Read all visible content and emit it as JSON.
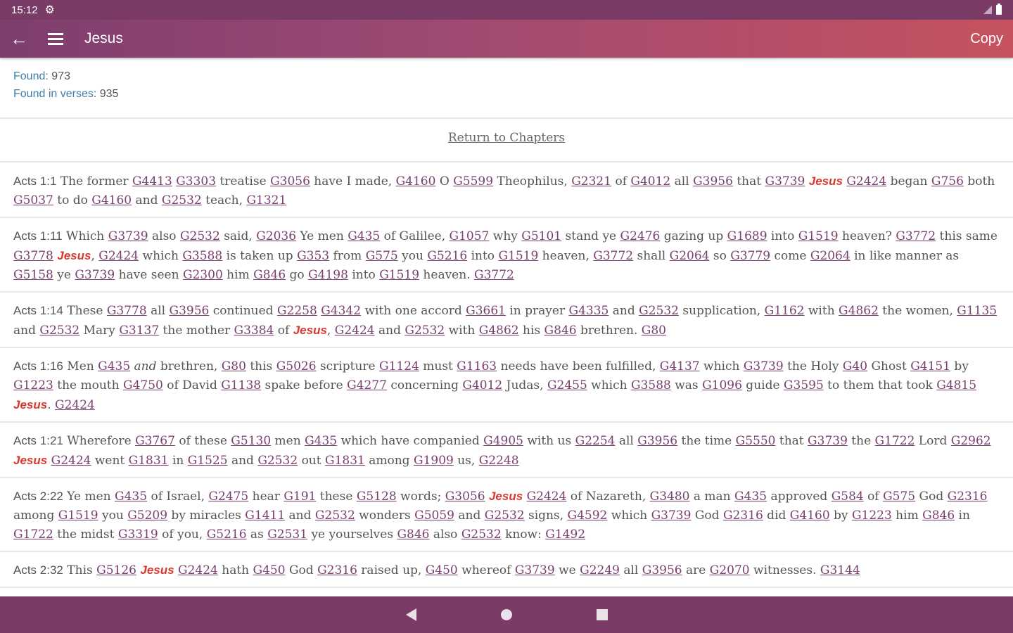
{
  "status_bar": {
    "time": "15:12",
    "gear_icon": "⚙"
  },
  "app_bar": {
    "title": "Jesus",
    "copy_label": "Copy",
    "back_icon": "←"
  },
  "summary": {
    "found_label": "Found:",
    "found_value": "973",
    "verses_label": "Found in verses:",
    "verses_value": "935"
  },
  "return_label": "Return to Chapters",
  "verses": [
    {
      "ref": "Acts 1:1",
      "tokens": [
        {
          "t": "The former "
        },
        {
          "s": "G4413"
        },
        {
          "t": " "
        },
        {
          "s": "G3303"
        },
        {
          "t": " treatise "
        },
        {
          "s": "G3056"
        },
        {
          "t": " have I made, "
        },
        {
          "s": "G4160"
        },
        {
          "t": " O "
        },
        {
          "s": "G5599"
        },
        {
          "t": " Theophilus, "
        },
        {
          "s": "G2321"
        },
        {
          "t": " of "
        },
        {
          "s": "G4012"
        },
        {
          "t": " all "
        },
        {
          "s": "G3956"
        },
        {
          "t": " that "
        },
        {
          "s": "G3739"
        },
        {
          "t": " "
        },
        {
          "j": "Jesus"
        },
        {
          "t": " "
        },
        {
          "s": "G2424"
        },
        {
          "t": " began "
        },
        {
          "s": "G756"
        },
        {
          "t": " both "
        },
        {
          "s": "G5037"
        },
        {
          "t": " to do "
        },
        {
          "s": "G4160"
        },
        {
          "t": " and "
        },
        {
          "s": "G2532"
        },
        {
          "t": " teach, "
        },
        {
          "s": "G1321"
        }
      ]
    },
    {
      "ref": "Acts 1:11",
      "tokens": [
        {
          "t": "Which "
        },
        {
          "s": "G3739"
        },
        {
          "t": " also "
        },
        {
          "s": "G2532"
        },
        {
          "t": " said, "
        },
        {
          "s": "G2036"
        },
        {
          "t": " Ye men "
        },
        {
          "s": "G435"
        },
        {
          "t": " of Galilee, "
        },
        {
          "s": "G1057"
        },
        {
          "t": " why "
        },
        {
          "s": "G5101"
        },
        {
          "t": " stand ye "
        },
        {
          "s": "G2476"
        },
        {
          "t": " gazing up "
        },
        {
          "s": "G1689"
        },
        {
          "t": " into "
        },
        {
          "s": "G1519"
        },
        {
          "t": " heaven? "
        },
        {
          "s": "G3772"
        },
        {
          "t": " this same "
        },
        {
          "s": "G3778"
        },
        {
          "t": " "
        },
        {
          "j": "Jesus"
        },
        {
          "t": ", "
        },
        {
          "s": "G2424"
        },
        {
          "t": " which "
        },
        {
          "s": "G3588"
        },
        {
          "t": " is taken up "
        },
        {
          "s": "G353"
        },
        {
          "t": " from "
        },
        {
          "s": "G575"
        },
        {
          "t": " you "
        },
        {
          "s": "G5216"
        },
        {
          "t": " into "
        },
        {
          "s": "G1519"
        },
        {
          "t": " heaven, "
        },
        {
          "s": "G3772"
        },
        {
          "t": " shall "
        },
        {
          "s": "G2064"
        },
        {
          "t": " so "
        },
        {
          "s": "G3779"
        },
        {
          "t": " come "
        },
        {
          "s": "G2064"
        },
        {
          "t": " in like manner as "
        },
        {
          "s": "G5158"
        },
        {
          "t": " ye "
        },
        {
          "s": "G3739"
        },
        {
          "t": " have seen "
        },
        {
          "s": "G2300"
        },
        {
          "t": " him "
        },
        {
          "s": "G846"
        },
        {
          "t": " go "
        },
        {
          "s": "G4198"
        },
        {
          "t": " into "
        },
        {
          "s": "G1519"
        },
        {
          "t": " heaven. "
        },
        {
          "s": "G3772"
        }
      ]
    },
    {
      "ref": "Acts 1:14",
      "tokens": [
        {
          "t": "These "
        },
        {
          "s": "G3778"
        },
        {
          "t": " all "
        },
        {
          "s": "G3956"
        },
        {
          "t": " continued "
        },
        {
          "s": "G2258"
        },
        {
          "t": " "
        },
        {
          "s": "G4342"
        },
        {
          "t": " with one accord "
        },
        {
          "s": "G3661"
        },
        {
          "t": " in prayer "
        },
        {
          "s": "G4335"
        },
        {
          "t": " and "
        },
        {
          "s": "G2532"
        },
        {
          "t": " supplication, "
        },
        {
          "s": "G1162"
        },
        {
          "t": " with "
        },
        {
          "s": "G4862"
        },
        {
          "t": " the women, "
        },
        {
          "s": "G1135"
        },
        {
          "t": " and "
        },
        {
          "s": "G2532"
        },
        {
          "t": " Mary "
        },
        {
          "s": "G3137"
        },
        {
          "t": " the mother "
        },
        {
          "s": "G3384"
        },
        {
          "t": " of "
        },
        {
          "j": "Jesus"
        },
        {
          "t": ", "
        },
        {
          "s": "G2424"
        },
        {
          "t": " and "
        },
        {
          "s": "G2532"
        },
        {
          "t": " with "
        },
        {
          "s": "G4862"
        },
        {
          "t": " his "
        },
        {
          "s": "G846"
        },
        {
          "t": " brethren. "
        },
        {
          "s": "G80"
        }
      ]
    },
    {
      "ref": "Acts 1:16",
      "tokens": [
        {
          "t": "Men "
        },
        {
          "s": "G435"
        },
        {
          "t": " "
        },
        {
          "i": "and"
        },
        {
          "t": " brethren, "
        },
        {
          "s": "G80"
        },
        {
          "t": " this "
        },
        {
          "s": "G5026"
        },
        {
          "t": " scripture "
        },
        {
          "s": "G1124"
        },
        {
          "t": " must "
        },
        {
          "s": "G1163"
        },
        {
          "t": " needs have been fulfilled, "
        },
        {
          "s": "G4137"
        },
        {
          "t": " which "
        },
        {
          "s": "G3739"
        },
        {
          "t": " the Holy "
        },
        {
          "s": "G40"
        },
        {
          "t": " Ghost "
        },
        {
          "s": "G4151"
        },
        {
          "t": " by "
        },
        {
          "s": "G1223"
        },
        {
          "t": " the mouth "
        },
        {
          "s": "G4750"
        },
        {
          "t": " of David "
        },
        {
          "s": "G1138"
        },
        {
          "t": " spake before "
        },
        {
          "s": "G4277"
        },
        {
          "t": " concerning "
        },
        {
          "s": "G4012"
        },
        {
          "t": " Judas, "
        },
        {
          "s": "G2455"
        },
        {
          "t": " which "
        },
        {
          "s": "G3588"
        },
        {
          "t": " was "
        },
        {
          "s": "G1096"
        },
        {
          "t": " guide "
        },
        {
          "s": "G3595"
        },
        {
          "t": " to them that took "
        },
        {
          "s": "G4815"
        },
        {
          "t": " "
        },
        {
          "j": "Jesus"
        },
        {
          "t": ". "
        },
        {
          "s": "G2424"
        }
      ]
    },
    {
      "ref": "Acts 1:21",
      "tokens": [
        {
          "t": "Wherefore "
        },
        {
          "s": "G3767"
        },
        {
          "t": " of these "
        },
        {
          "s": "G5130"
        },
        {
          "t": " men "
        },
        {
          "s": "G435"
        },
        {
          "t": " which have companied "
        },
        {
          "s": "G4905"
        },
        {
          "t": " with us "
        },
        {
          "s": "G2254"
        },
        {
          "t": " all "
        },
        {
          "s": "G3956"
        },
        {
          "t": " the time "
        },
        {
          "s": "G5550"
        },
        {
          "t": " that "
        },
        {
          "s": "G3739"
        },
        {
          "t": " the "
        },
        {
          "s": "G1722"
        },
        {
          "t": " Lord "
        },
        {
          "s": "G2962"
        },
        {
          "t": " "
        },
        {
          "j": "Jesus"
        },
        {
          "t": " "
        },
        {
          "s": "G2424"
        },
        {
          "t": " went "
        },
        {
          "s": "G1831"
        },
        {
          "t": " in "
        },
        {
          "s": "G1525"
        },
        {
          "t": " and "
        },
        {
          "s": "G2532"
        },
        {
          "t": " out "
        },
        {
          "s": "G1831"
        },
        {
          "t": " among "
        },
        {
          "s": "G1909"
        },
        {
          "t": " us, "
        },
        {
          "s": "G2248"
        }
      ]
    },
    {
      "ref": "Acts 2:22",
      "tokens": [
        {
          "t": "Ye men "
        },
        {
          "s": "G435"
        },
        {
          "t": " of Israel, "
        },
        {
          "s": "G2475"
        },
        {
          "t": " hear "
        },
        {
          "s": "G191"
        },
        {
          "t": " these "
        },
        {
          "s": "G5128"
        },
        {
          "t": " words; "
        },
        {
          "s": "G3056"
        },
        {
          "t": " "
        },
        {
          "j": "Jesus"
        },
        {
          "t": " "
        },
        {
          "s": "G2424"
        },
        {
          "t": " of Nazareth, "
        },
        {
          "s": "G3480"
        },
        {
          "t": " a man "
        },
        {
          "s": "G435"
        },
        {
          "t": " approved "
        },
        {
          "s": "G584"
        },
        {
          "t": " of "
        },
        {
          "s": "G575"
        },
        {
          "t": " God "
        },
        {
          "s": "G2316"
        },
        {
          "t": " among "
        },
        {
          "s": "G1519"
        },
        {
          "t": " you "
        },
        {
          "s": "G5209"
        },
        {
          "t": " by miracles "
        },
        {
          "s": "G1411"
        },
        {
          "t": " and "
        },
        {
          "s": "G2532"
        },
        {
          "t": " wonders "
        },
        {
          "s": "G5059"
        },
        {
          "t": " and "
        },
        {
          "s": "G2532"
        },
        {
          "t": " signs, "
        },
        {
          "s": "G4592"
        },
        {
          "t": " which "
        },
        {
          "s": "G3739"
        },
        {
          "t": " God "
        },
        {
          "s": "G2316"
        },
        {
          "t": " did "
        },
        {
          "s": "G4160"
        },
        {
          "t": " by "
        },
        {
          "s": "G1223"
        },
        {
          "t": " him "
        },
        {
          "s": "G846"
        },
        {
          "t": " in "
        },
        {
          "s": "G1722"
        },
        {
          "t": " the midst "
        },
        {
          "s": "G3319"
        },
        {
          "t": " of you, "
        },
        {
          "s": "G5216"
        },
        {
          "t": " as "
        },
        {
          "s": "G2531"
        },
        {
          "t": " ye yourselves "
        },
        {
          "s": "G846"
        },
        {
          "t": " also "
        },
        {
          "s": "G2532"
        },
        {
          "t": " know: "
        },
        {
          "s": "G1492"
        }
      ]
    },
    {
      "ref": "Acts 2:32",
      "tokens": [
        {
          "t": "This "
        },
        {
          "s": "G5126"
        },
        {
          "t": " "
        },
        {
          "j": "Jesus"
        },
        {
          "t": " "
        },
        {
          "s": "G2424"
        },
        {
          "t": " hath "
        },
        {
          "s": "G450"
        },
        {
          "t": " God "
        },
        {
          "s": "G2316"
        },
        {
          "t": " raised up, "
        },
        {
          "s": "G450"
        },
        {
          "t": " whereof "
        },
        {
          "s": "G3739"
        },
        {
          "t": " we "
        },
        {
          "s": "G2249"
        },
        {
          "t": " all "
        },
        {
          "s": "G3956"
        },
        {
          "t": " are "
        },
        {
          "s": "G2070"
        },
        {
          "t": " witnesses. "
        },
        {
          "s": "G3144"
        }
      ]
    }
  ],
  "colors": {
    "header_start": "#7d3e6e",
    "header_end": "#c6525f",
    "jesus_red": "#d9382d",
    "strong_link": "#7a4070",
    "label_blue": "#3f7ea6"
  }
}
